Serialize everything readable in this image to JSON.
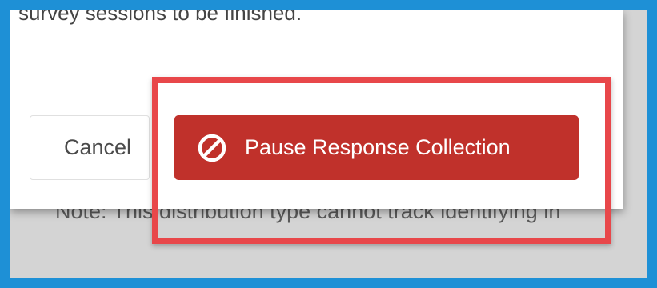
{
  "dialog": {
    "body_text": "survey sessions to be finished.",
    "cancel_label": "Cancel",
    "confirm_label": "Pause Response Collection",
    "confirm_icon": "no-entry-circle-icon"
  },
  "background": {
    "note_text": "Note: This distribution type cannot track identifying in"
  },
  "colors": {
    "confirm_button": "#c0312b",
    "highlight": "#e8474a",
    "outer_border": "#1e90d6"
  }
}
